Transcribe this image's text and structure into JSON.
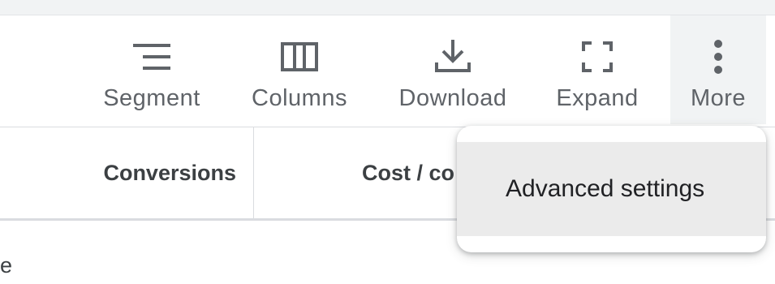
{
  "toolbar": {
    "segment_label": "Segment",
    "columns_label": "Columns",
    "download_label": "Download",
    "expand_label": "Expand",
    "more_label": "More"
  },
  "table": {
    "columns": [
      "Conversions",
      "Cost / co"
    ],
    "row_fragment": "e"
  },
  "more_menu": {
    "items": [
      {
        "label": "Advanced settings"
      }
    ]
  },
  "colors": {
    "icon": "#5f6368",
    "label": "#5f6368",
    "header_text": "#3c4043",
    "menu_hover": "#ebebeb",
    "more_active_bg": "#f1f3f4"
  },
  "icons": {
    "segment": "segment-lines-icon",
    "columns": "view-column-icon",
    "download": "download-icon",
    "expand": "fullscreen-icon",
    "more": "more-vert-icon"
  }
}
